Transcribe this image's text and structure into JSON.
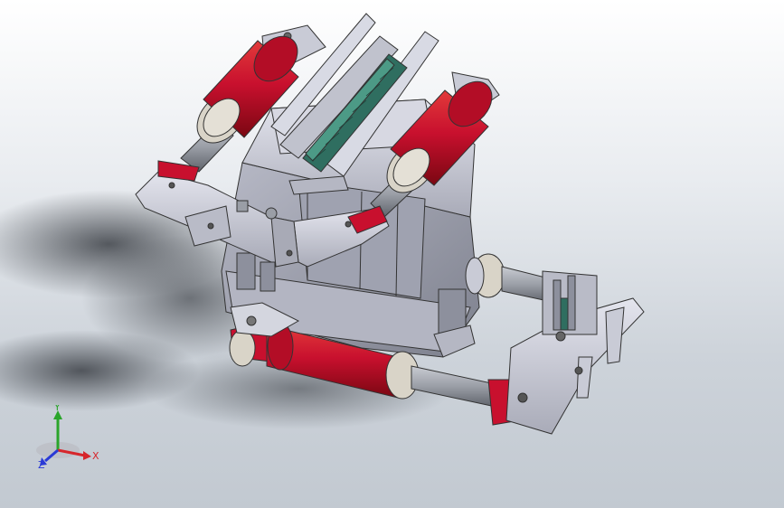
{
  "viewport": {
    "background_top": "#ffffff",
    "background_bottom": "#c2c9d1"
  },
  "model": {
    "cylinder_color": "#c8102e",
    "body_color": "#c9cbd6",
    "bearing_color": "#d9d4c8",
    "rod_color": "#9a9ea6",
    "rail_color": "#2f6e60",
    "edge_color": "#333333"
  },
  "triad": {
    "x_label": "X",
    "y_label": "Y",
    "z_label": "Z",
    "x_color": "#d6262b",
    "y_color": "#2aa52a",
    "z_color": "#2a3ad6"
  }
}
